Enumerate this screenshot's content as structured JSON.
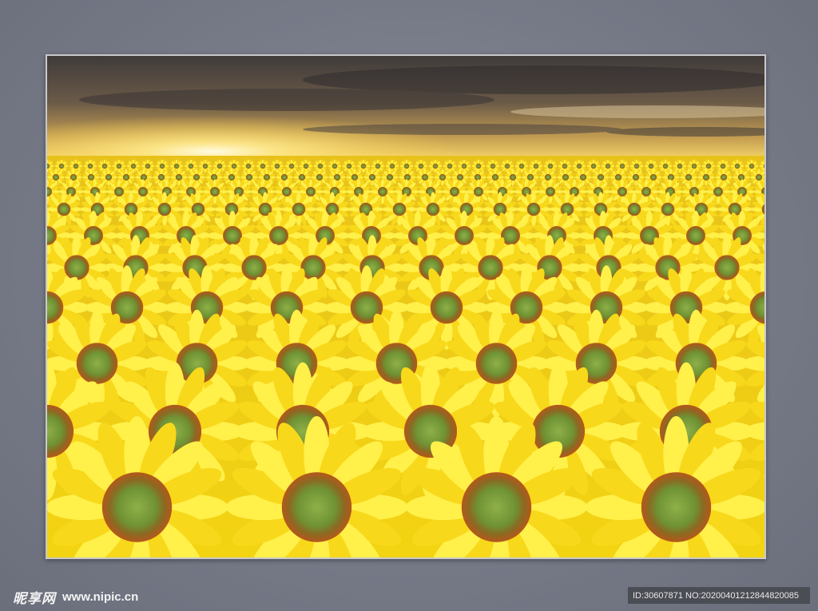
{
  "image": {
    "description_icon": "sunflower-field-photo",
    "colors": {
      "sky_dark": "#4a4440",
      "sky_glow": "#ffe88a",
      "petal": "#f8d81a",
      "petal_light": "#fff04a",
      "seed_ring": "#b5601a",
      "seed_center": "#7fa23a"
    }
  },
  "watermark": {
    "brand": "昵享网",
    "url": "www.nipic.cn"
  },
  "id_bar": {
    "text": "ID:30607871 NO:20200401212844820085"
  }
}
